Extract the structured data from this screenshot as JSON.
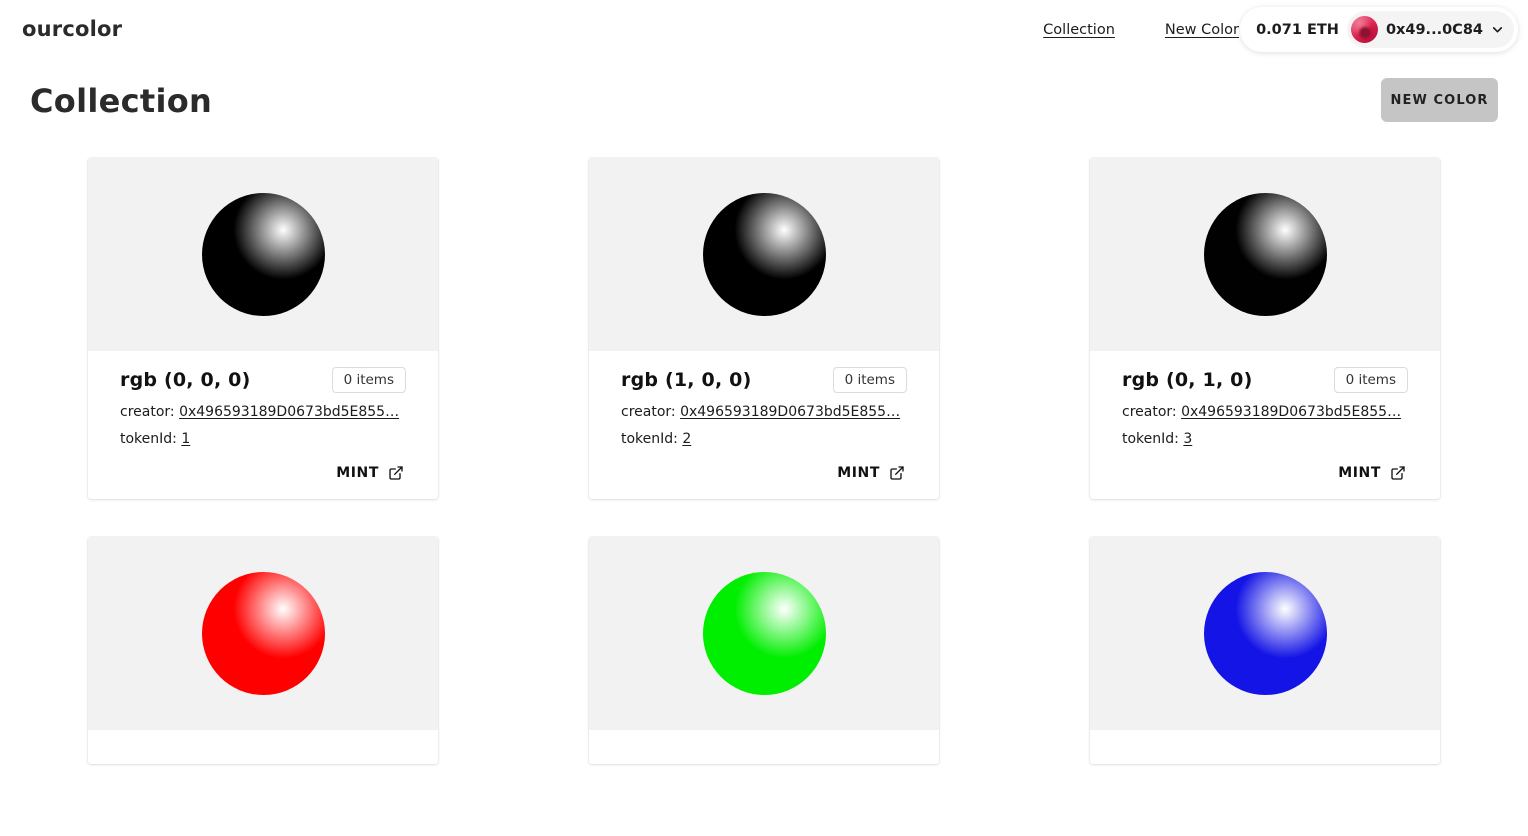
{
  "header": {
    "logo": "ourcolor",
    "nav": [
      {
        "label": "Collection",
        "name": "nav-collection"
      },
      {
        "label": "New Color",
        "name": "nav-new-color"
      }
    ],
    "wallet": {
      "balance": "0.071 ETH",
      "address": "0x49...0C84",
      "avatar_icon": "jazzicon-avatar",
      "chevron_icon": "chevron-down-icon",
      "avatar_color": "#d9204c"
    }
  },
  "page": {
    "title": "Collection",
    "new_color_button": "NEW COLOR",
    "new_color_button_color": "#c5c5c5"
  },
  "labels": {
    "creator_prefix": "creator:",
    "token_prefix": "tokenId:",
    "mint": "MINT",
    "mint_icon": "external-link-icon"
  },
  "cards": [
    {
      "title": "rgb (0, 0, 0)",
      "items": "0 items",
      "creator": "0x496593189D0673bd5E855…",
      "tokenId": "1",
      "mint": "MINT",
      "color": "#000000"
    },
    {
      "title": "rgb (1, 0, 0)",
      "items": "0 items",
      "creator": "0x496593189D0673bd5E855…",
      "tokenId": "2",
      "mint": "MINT",
      "color": "#010000"
    },
    {
      "title": "rgb (0, 1, 0)",
      "items": "0 items",
      "creator": "0x496593189D0673bd5E855…",
      "tokenId": "3",
      "mint": "MINT",
      "color": "#000100"
    },
    {
      "title": "",
      "items": "",
      "creator": "",
      "tokenId": "",
      "mint": "",
      "color": "#ff0000"
    },
    {
      "title": "",
      "items": "",
      "creator": "",
      "tokenId": "",
      "mint": "",
      "color": "#00ee00"
    },
    {
      "title": "",
      "items": "",
      "creator": "",
      "tokenId": "",
      "mint": "",
      "color": "#1414e6"
    }
  ]
}
